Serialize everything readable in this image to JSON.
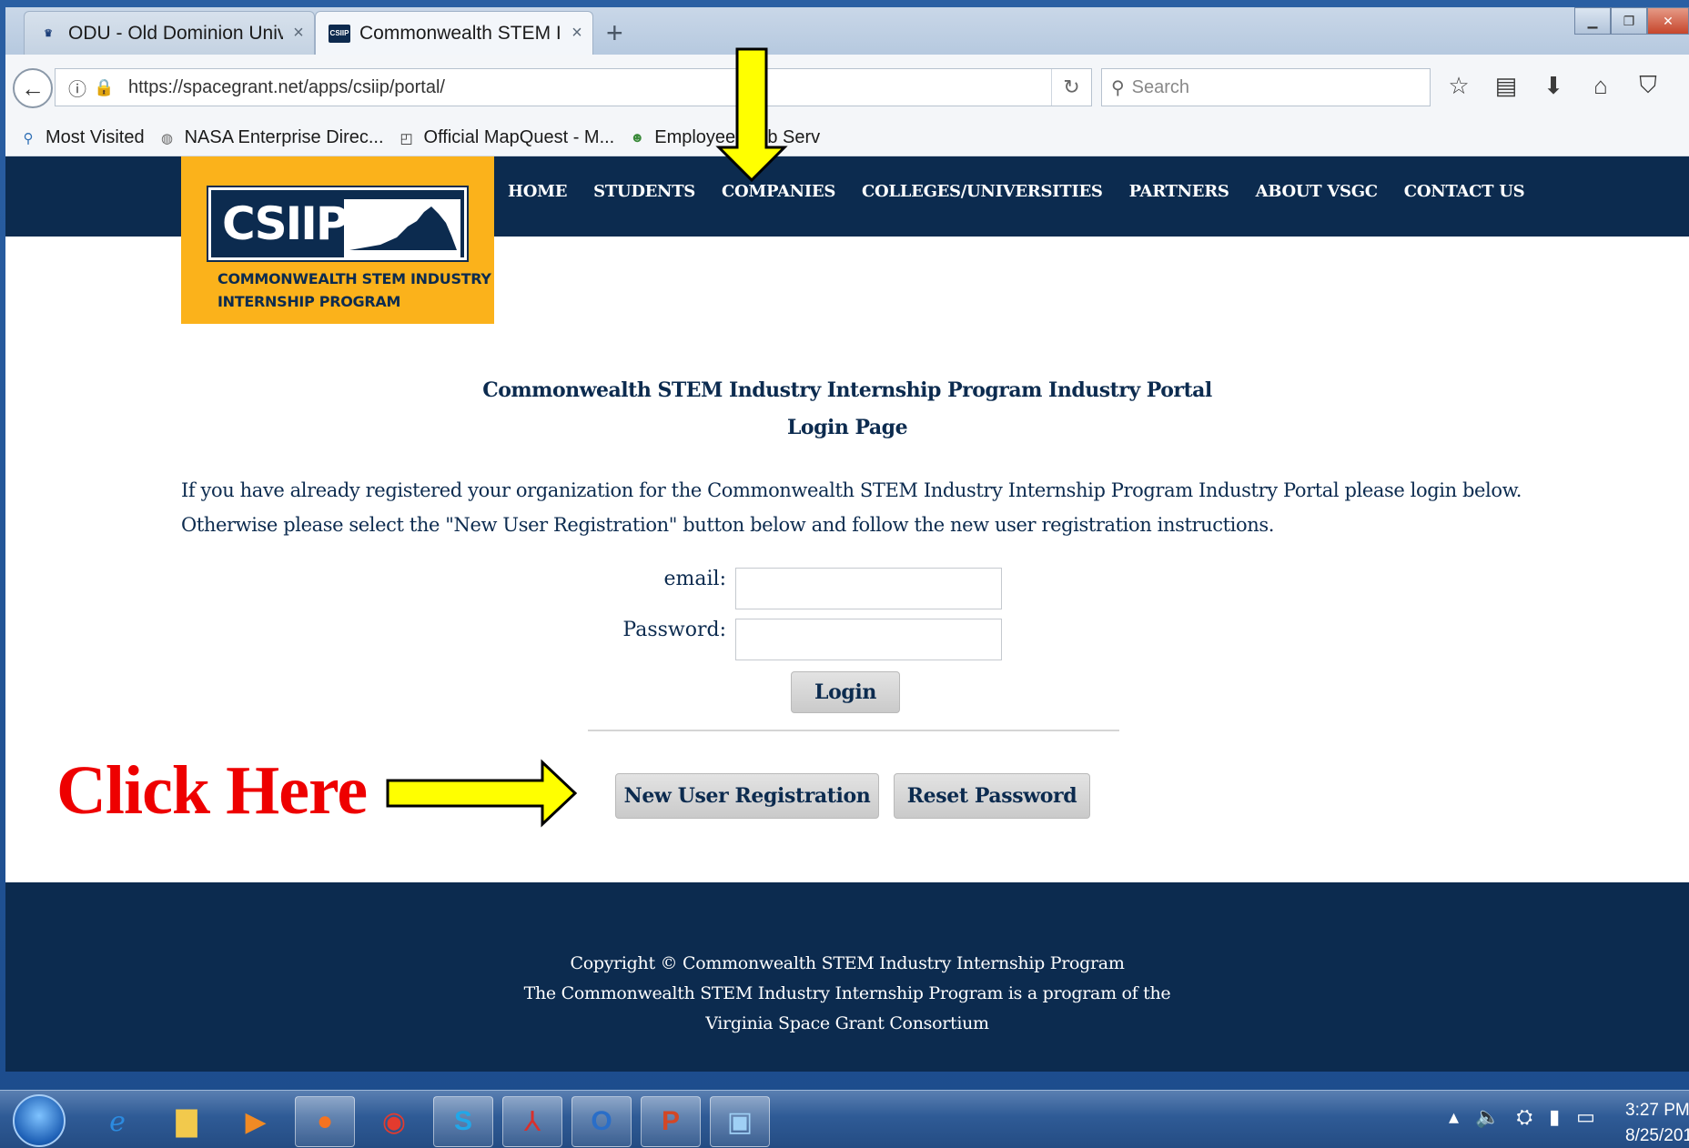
{
  "browser": {
    "tabs": [
      {
        "title": "ODU - Old Dominion Univ...",
        "close": "×"
      },
      {
        "title": "Commonwealth STEM Ind...",
        "close": "×"
      }
    ],
    "new_tab": "+",
    "url": "https://spacegrant.net/apps/csiip/portal/",
    "search_placeholder": "Search",
    "bookmarks": [
      "Most Visited",
      "NASA Enterprise Direc...",
      "Official MapQuest - M...",
      "Employee Web Serv"
    ]
  },
  "site": {
    "logo_text": "CSIIP",
    "logo_tagline_1": "COMMONWEALTH STEM INDUSTRY",
    "logo_tagline_2": "INTERNSHIP PROGRAM",
    "nav": [
      "HOME",
      "STUDENTS",
      "COMPANIES",
      "COLLEGES/UNIVERSITIES",
      "PARTNERS",
      "ABOUT VSGC",
      "CONTACT US"
    ]
  },
  "login": {
    "title": "Commonwealth STEM Industry Internship Program Industry Portal",
    "subtitle": "Login Page",
    "intro_1": "If you have already registered your organization for the Commonwealth STEM Industry Internship Program Industry Portal please login below.",
    "intro_2": "Otherwise please select the \"New User Registration\" button below and follow the new user registration instructions.",
    "email_label": "email:",
    "password_label": "Password:",
    "email_value": "",
    "password_value": "",
    "login_button": "Login",
    "register_button": "New User Registration",
    "reset_button": "Reset Password"
  },
  "footer": {
    "line1": "Copyright © Commonwealth STEM Industry Internship Program",
    "line2": "The Commonwealth STEM Industry Internship Program is a program of the",
    "line3": "Virginia Space Grant Consortium"
  },
  "annotation": {
    "click_here": "Click Here",
    "color": "#ee0000",
    "arrow_color": "#ffff00"
  },
  "taskbar": {
    "time": "3:27 PM",
    "date": "8/25/201"
  },
  "colors": {
    "navy": "#0c2b4f",
    "logo_gold": "#fbb21b"
  }
}
